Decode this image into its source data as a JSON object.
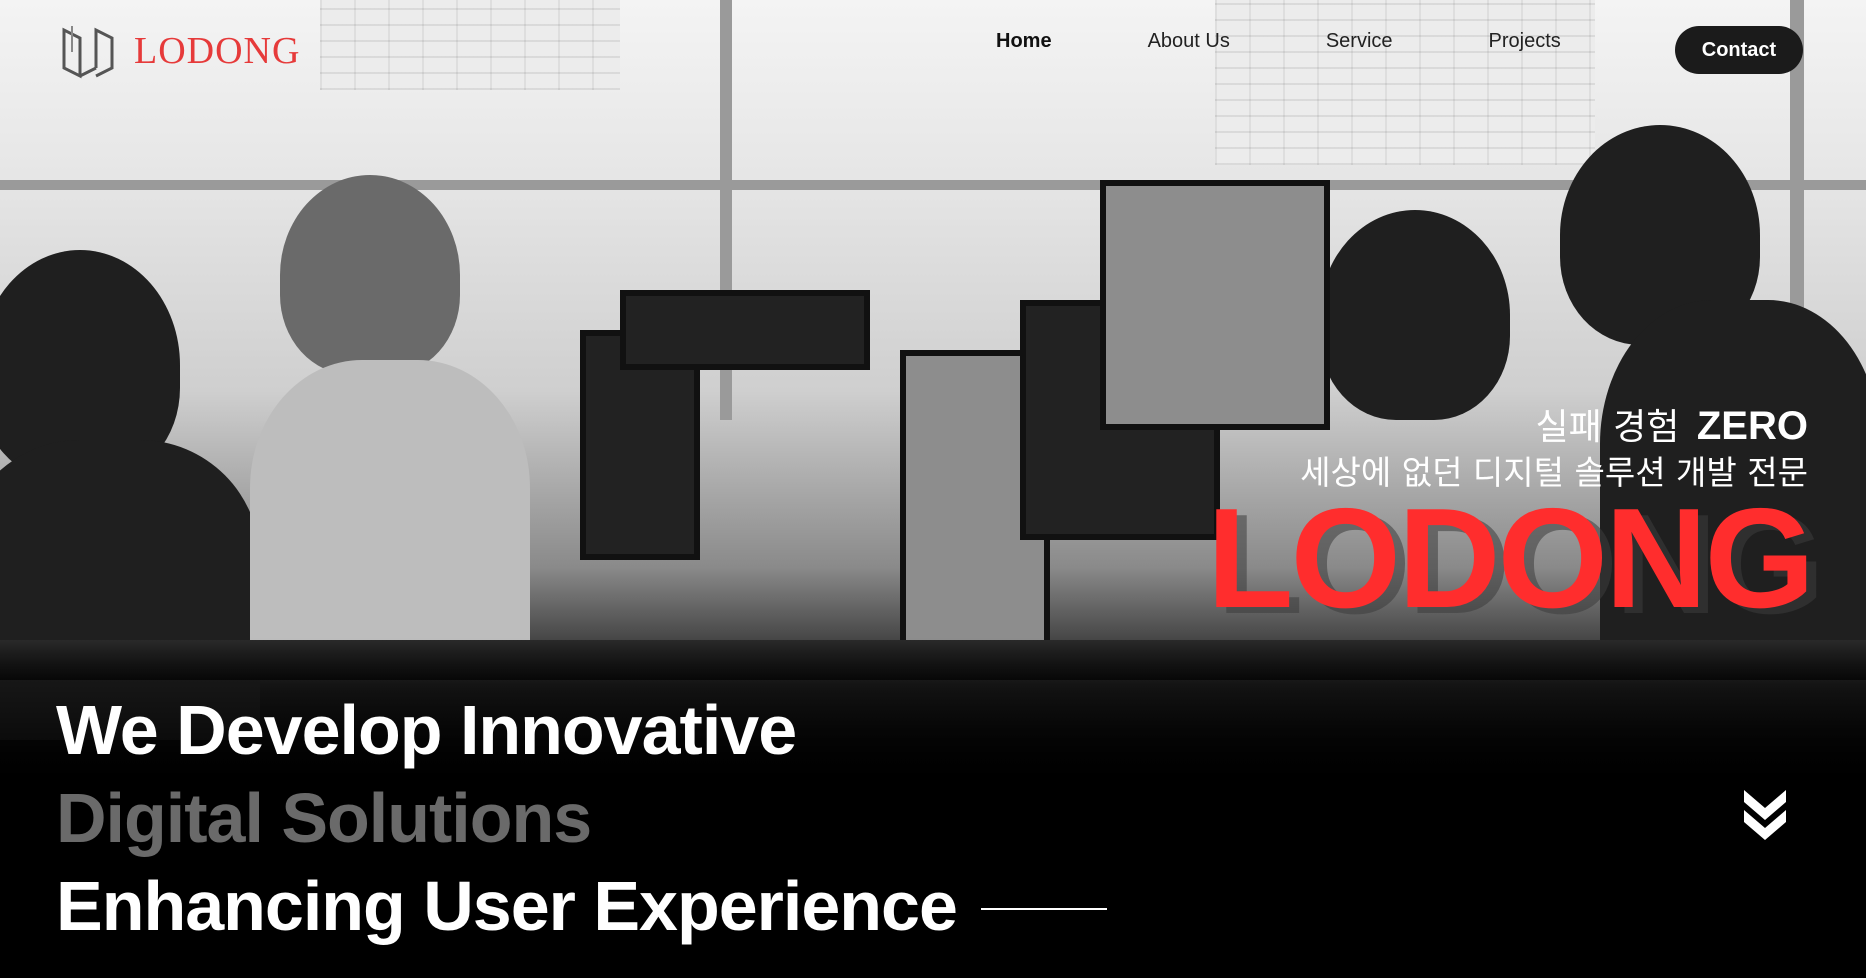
{
  "brand": {
    "name": "LODONG",
    "logo_color": "#e63a3a"
  },
  "nav": {
    "items": [
      {
        "label": "Home",
        "active": true
      },
      {
        "label": "About Us",
        "active": false
      },
      {
        "label": "Service",
        "active": false
      },
      {
        "label": "Projects",
        "active": false
      }
    ],
    "contact_label": "Contact"
  },
  "hero": {
    "tagline_kr_1": "실패 경험",
    "tagline_zero": "ZERO",
    "tagline_kr_2": "세상에 없던 디지털 솔루션 개발 전문",
    "big_brand": "LODONG",
    "big_brand_color": "#ff2d2d",
    "headline": {
      "line1": "We Develop Innovative",
      "line2": "Digital Solutions",
      "line3": "Enhancing User Experience"
    },
    "scroll_icon": "double-chevron-down-icon"
  }
}
